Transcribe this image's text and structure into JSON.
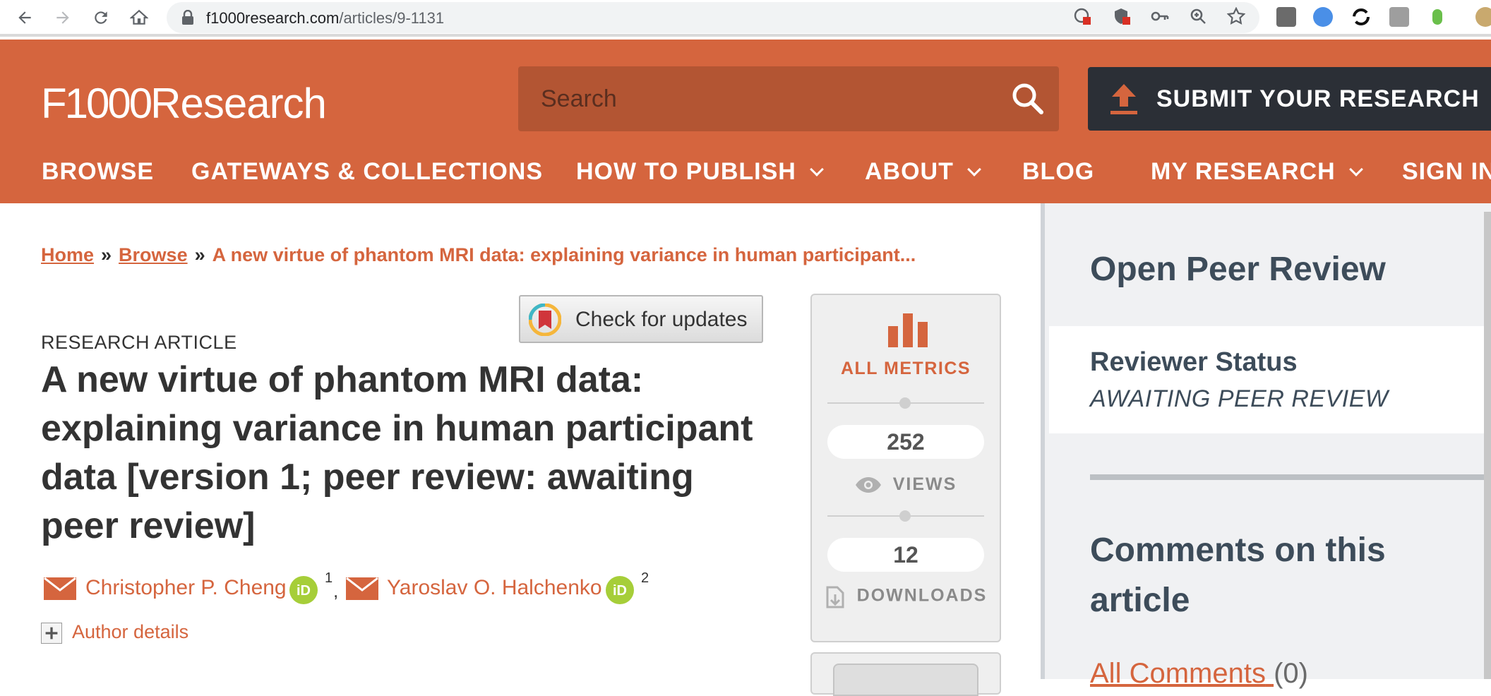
{
  "browser": {
    "url_host": "f1000research.com",
    "url_path": "/articles/9-1131"
  },
  "header": {
    "logo_f1000": "F1000",
    "logo_research": "Research",
    "search_placeholder": "Search",
    "submit_label": "SUBMIT YOUR RESEARCH",
    "nav": [
      {
        "label": "BROWSE",
        "has_dropdown": false
      },
      {
        "label": "GATEWAYS & COLLECTIONS",
        "has_dropdown": false
      },
      {
        "label": "HOW TO PUBLISH",
        "has_dropdown": true
      },
      {
        "label": "ABOUT",
        "has_dropdown": true
      },
      {
        "label": "BLOG",
        "has_dropdown": false
      },
      {
        "label": "MY RESEARCH",
        "has_dropdown": true
      },
      {
        "label": "SIGN IN",
        "has_dropdown": false
      }
    ]
  },
  "breadcrumb": {
    "home": "Home",
    "browse": "Browse",
    "sep": "»",
    "current": "A new virtue of phantom MRI data: explaining variance in human participant..."
  },
  "article": {
    "updates_label": "Check for updates",
    "type": "RESEARCH ARTICLE",
    "title": "A new virtue of phantom MRI data: explaining variance in human participant data [version 1; peer review: awaiting peer review]",
    "authors": [
      {
        "name": "Christopher P. Cheng",
        "affiliation": "1",
        "separator": ","
      },
      {
        "name": "Yaroslav O. Halchenko",
        "affiliation": "2",
        "separator": ""
      }
    ],
    "author_details": "Author details"
  },
  "metrics": {
    "all_metrics": "ALL METRICS",
    "views_count": "252",
    "views_label": "VIEWS",
    "downloads_count": "12",
    "downloads_label": "DOWNLOADS"
  },
  "sidebar": {
    "open_peer_review": "Open Peer Review",
    "reviewer_status_title": "Reviewer Status",
    "reviewer_status_value": "AWAITING PEER REVIEW",
    "comments_heading": "Comments on this article",
    "all_comments": "All Comments",
    "all_comments_count": "(0)"
  },
  "colors": {
    "brand": "#d5653e",
    "dark_button": "#2b2f36",
    "heading": "#3d4c5a",
    "orcid": "#a6ce39"
  }
}
